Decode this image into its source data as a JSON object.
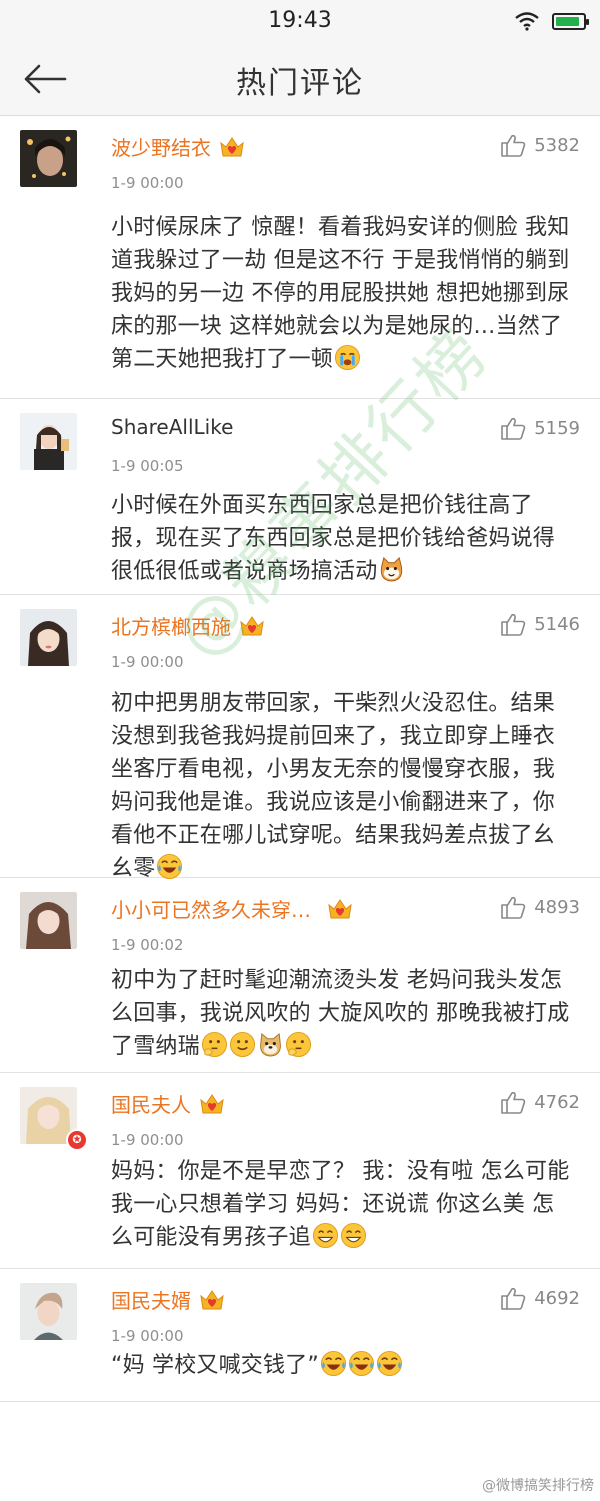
{
  "status_bar": {
    "time": "19:43",
    "battery_level": 0.9
  },
  "nav": {
    "title": "热门评论"
  },
  "comments": [
    {
      "username": "波少野结衣",
      "vip": true,
      "time": "1-9 00:00",
      "likes": "5382",
      "text": "小时候尿床了 惊醒！看着我妈安详的侧脸 我知道我躲过了一劫 但是这不行 于是我悄悄的躺到我妈的另一边 不停的用屁股拱她 想把她挪到尿床的那一块 这样她就会以为是她尿的…当然了 第二天她把我打了一顿",
      "emojis": [
        "crying-emoji"
      ]
    },
    {
      "username": "ShareAllLike",
      "vip": false,
      "time": "1-9 00:05",
      "likes": "5159",
      "text": "小时候在外面买东西回家总是把价钱往高了报，现在买了东西回家总是把价钱给爸妈说得很低很低或者说商场搞活动",
      "emojis": [
        "cat-emoji"
      ]
    },
    {
      "username": "北方槟榔西施",
      "vip": true,
      "time": "1-9 00:00",
      "likes": "5146",
      "text": "初中把男朋友带回家，干柴烈火没忍住。结果没想到我爸我妈提前回来了，我立即穿上睡衣坐客厅看电视，小男友无奈的慢慢穿衣服，我妈问我他是谁。我说应该是小偷翻进来了，你看他不正在哪儿试穿呢。结果我妈差点拔了幺幺零",
      "emojis": [
        "laugh-tears-emoji"
      ]
    },
    {
      "username": "小小可已然多久未穿…",
      "vip": true,
      "time": "1-9 00:02",
      "likes": "4893",
      "text": "初中为了赶时髦迎潮流烫头发 老妈问我头发怎么回事，我说风吹的 大旋风吹的 那晚我被打成了雪纳瑞",
      "emojis": [
        "thinking-emoji",
        "smile-emoji",
        "doge-emoji",
        "thinking-emoji"
      ]
    },
    {
      "username": "国民夫人",
      "vip": true,
      "verified": true,
      "time": "1-9 00:00",
      "likes": "4762",
      "text": "妈妈：你是不是早恋了？ 我：没有啦 怎么可能 我一心只想着学习 妈妈：还说谎 你这么美 怎么可能没有男孩子追",
      "emojis": [
        "grin-emoji",
        "grin-emoji"
      ]
    },
    {
      "username": "国民夫婿",
      "vip": true,
      "time": "1-9 00:00",
      "likes": "4692",
      "text": "“妈 学校又喊交钱了”",
      "emojis": [
        "laugh-tears-emoji",
        "laugh-tears-emoji",
        "laugh-tears-emoji"
      ]
    }
  ],
  "watermark": {
    "text": "@糗事排行榜"
  },
  "footer": {
    "text": "@微博搞笑排行榜"
  },
  "colors": {
    "username": "#eb7420",
    "vip_gold": "#f5b324",
    "vip_red": "#e8382f"
  }
}
